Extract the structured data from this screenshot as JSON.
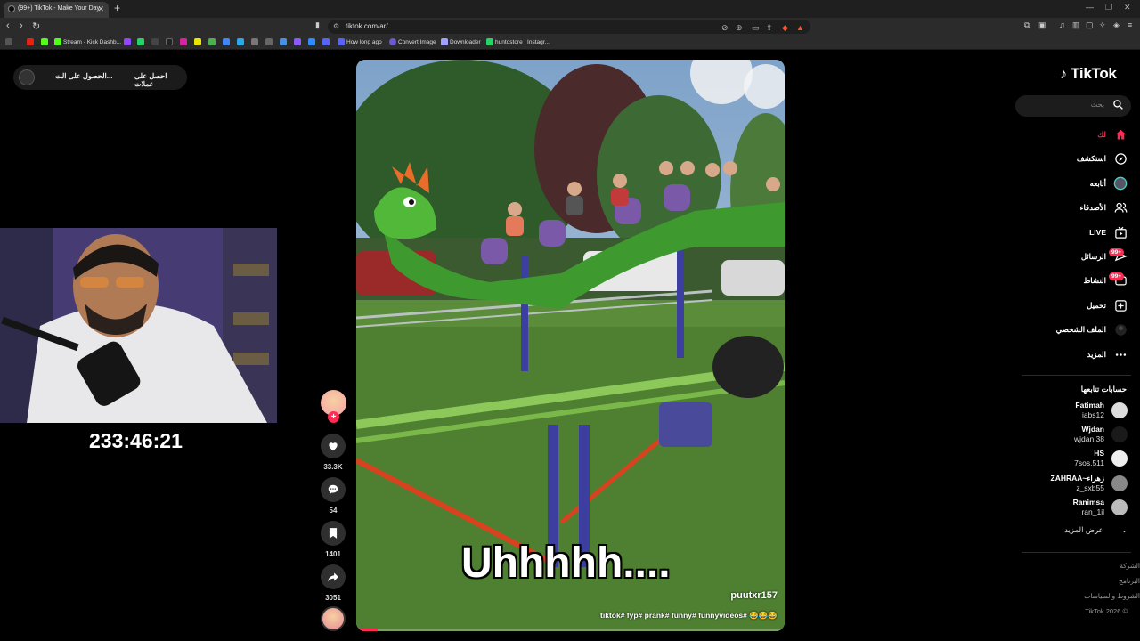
{
  "browser": {
    "tab_title": "(99+) TikTok - Make Your Day",
    "url": "tiktok.com/ar/",
    "bookmarks": [
      "Stream - Kick Dashb...",
      "How long ago",
      "Convert Image",
      "Downloader",
      "huntostore | Instagr..."
    ]
  },
  "overlay": {
    "btn1": "احصل على عملات",
    "btn2": "الحصول على الت..."
  },
  "stream": {
    "timer": "233:46:21"
  },
  "video": {
    "caption": "Uhhhhh....",
    "author": "puutxr157",
    "tags": "tiktok# fyp# prank# funny# funnyvideos# 😂😂😂",
    "progress": 0.05
  },
  "actions": {
    "likes": "33.3K",
    "comments": "54",
    "saves": "1401",
    "shares": "3051"
  },
  "sidebar": {
    "logo": "TikTok",
    "search_placeholder": "بحث",
    "nav": [
      {
        "label": "لك",
        "icon": "home-icon",
        "active": true
      },
      {
        "label": "استكشف",
        "icon": "compass-icon"
      },
      {
        "label": "أتابعه",
        "icon": "following-icon"
      },
      {
        "label": "الأصدقاء",
        "icon": "friends-icon"
      },
      {
        "label": "LIVE",
        "icon": "live-icon"
      },
      {
        "label": "الرسائل",
        "icon": "messages-icon",
        "badge": "99+"
      },
      {
        "label": "النشاط",
        "icon": "activity-icon",
        "badge": "99+"
      },
      {
        "label": "تحميل",
        "icon": "upload-icon"
      },
      {
        "label": "الملف الشخصي",
        "icon": "profile-icon"
      },
      {
        "label": "المزيد",
        "icon": "more-icon"
      }
    ],
    "following_title": "حسابات تتابعها",
    "accounts": [
      {
        "name": "Fatimah",
        "handle": "iabs12"
      },
      {
        "name": "Wjdan",
        "handle": "wjdan.38"
      },
      {
        "name": "HS",
        "handle": "7sos.511"
      },
      {
        "name": "ZAHRAA~زهراء",
        "handle": "z_sxb55"
      },
      {
        "name": "Ranimsa",
        "handle": "ran_1il"
      }
    ],
    "see_more": "عرض المزيد",
    "footer": [
      "الشركة",
      "البرنامج",
      "الشروط والسياسات",
      "TikTok 2026 ©"
    ]
  },
  "colors": {
    "accent": "#fe2c55",
    "bg": "#000000"
  }
}
